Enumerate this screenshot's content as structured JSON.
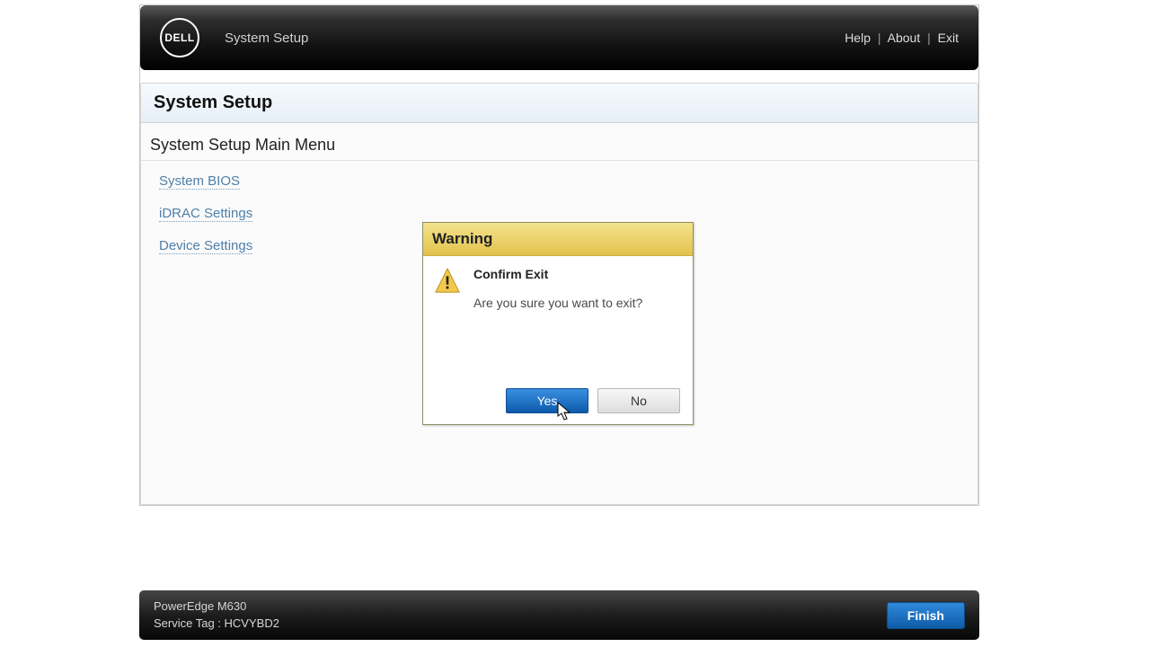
{
  "header": {
    "logo_text": "DELL",
    "app_title": "System Setup",
    "links": {
      "help": "Help",
      "about": "About",
      "exit": "Exit"
    }
  },
  "page": {
    "section_title": "System Setup",
    "subsection_title": "System Setup Main Menu",
    "menu": {
      "bios": "System BIOS",
      "idrac": "iDRAC Settings",
      "device": "Device Settings"
    }
  },
  "modal": {
    "title": "Warning",
    "heading": "Confirm Exit",
    "message": "Are you sure you want to exit?",
    "yes": "Yes",
    "no": "No"
  },
  "footer": {
    "model": "PowerEdge M630",
    "service_tag_label": "Service Tag : ",
    "service_tag": "HCVYBD2",
    "finish": "Finish"
  }
}
